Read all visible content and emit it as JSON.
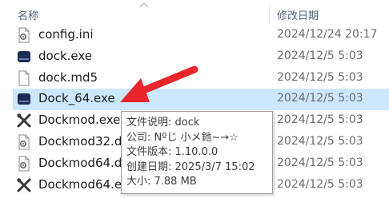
{
  "header": {
    "name_label": "名称",
    "date_label": "修改日期"
  },
  "files": [
    {
      "name": "config.ini",
      "date": "2024/12/24 20:17",
      "icon": "settings-file-icon"
    },
    {
      "name": "dock.exe",
      "date": "2024/12/5 5:03",
      "icon": "dock-app-icon"
    },
    {
      "name": "dock.md5",
      "date": "2024/12/5 5:03",
      "icon": "blank-file-icon"
    },
    {
      "name": "Dock_64.exe",
      "date": "2024/12/5 5:03",
      "icon": "dock-app-icon",
      "selected": true
    },
    {
      "name": "Dockmod.exe",
      "date": "2024/12/5 5:03",
      "icon": "tools-icon"
    },
    {
      "name": "Dockmod32.d",
      "date": "2024/12/5 5:03",
      "icon": "settings-file-icon"
    },
    {
      "name": "Dockmod64.d",
      "date": "2024/12/5 5:03",
      "icon": "settings-file-icon"
    },
    {
      "name": "Dockmod64.e",
      "date": "2024/12/5 5:03",
      "icon": "tools-icon"
    }
  ],
  "tooltip": {
    "description": "文件说明: dock",
    "company": "公司: Nºじ 小メ釶~→☆",
    "version": "文件版本: 1.10.0.0",
    "created": "创建日期: 2025/3/7 15:02",
    "size": "大小: 7.88 MB"
  },
  "colors": {
    "selection": "#cce8ff",
    "arrow": "#e8262b",
    "header_text": "#4c607a",
    "date_text": "#6b6b6b"
  }
}
